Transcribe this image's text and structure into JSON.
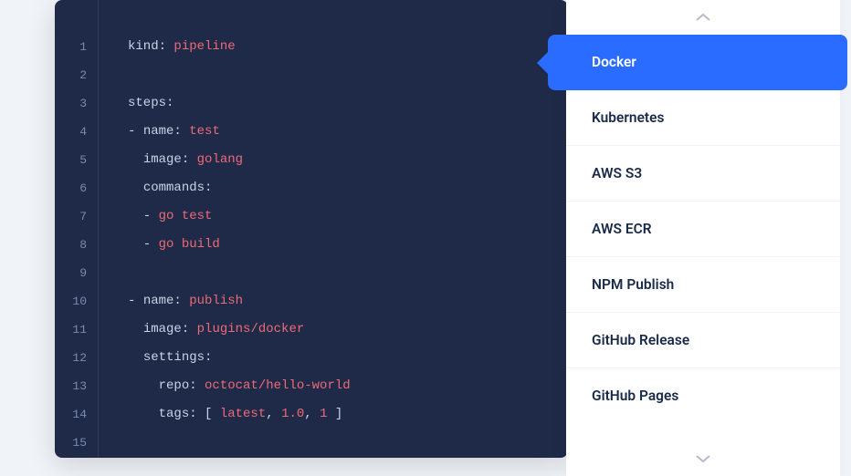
{
  "editor": {
    "line_count": 15,
    "lines": [
      [
        {
          "t": "key",
          "v": "kind"
        },
        {
          "t": "punct",
          "v": ": "
        },
        {
          "t": "val",
          "v": "pipeline"
        }
      ],
      [],
      [
        {
          "t": "key",
          "v": "steps"
        },
        {
          "t": "punct",
          "v": ":"
        }
      ],
      [
        {
          "t": "dash",
          "v": "- "
        },
        {
          "t": "key",
          "v": "name"
        },
        {
          "t": "punct",
          "v": ": "
        },
        {
          "t": "val",
          "v": "test"
        }
      ],
      [
        {
          "t": "dash",
          "v": "  "
        },
        {
          "t": "key",
          "v": "image"
        },
        {
          "t": "punct",
          "v": ": "
        },
        {
          "t": "val",
          "v": "golang"
        }
      ],
      [
        {
          "t": "dash",
          "v": "  "
        },
        {
          "t": "key",
          "v": "commands"
        },
        {
          "t": "punct",
          "v": ":"
        }
      ],
      [
        {
          "t": "dash",
          "v": "  - "
        },
        {
          "t": "val",
          "v": "go test"
        }
      ],
      [
        {
          "t": "dash",
          "v": "  - "
        },
        {
          "t": "val",
          "v": "go build"
        }
      ],
      [],
      [
        {
          "t": "dash",
          "v": "- "
        },
        {
          "t": "key",
          "v": "name"
        },
        {
          "t": "punct",
          "v": ": "
        },
        {
          "t": "val",
          "v": "publish"
        }
      ],
      [
        {
          "t": "dash",
          "v": "  "
        },
        {
          "t": "key",
          "v": "image"
        },
        {
          "t": "punct",
          "v": ": "
        },
        {
          "t": "val",
          "v": "plugins/docker"
        }
      ],
      [
        {
          "t": "dash",
          "v": "  "
        },
        {
          "t": "key",
          "v": "settings"
        },
        {
          "t": "punct",
          "v": ":"
        }
      ],
      [
        {
          "t": "dash",
          "v": "    "
        },
        {
          "t": "key",
          "v": "repo"
        },
        {
          "t": "punct",
          "v": ": "
        },
        {
          "t": "val",
          "v": "octocat/hello-world"
        }
      ],
      [
        {
          "t": "dash",
          "v": "    "
        },
        {
          "t": "key",
          "v": "tags"
        },
        {
          "t": "punct",
          "v": ": [ "
        },
        {
          "t": "val",
          "v": "latest"
        },
        {
          "t": "punct",
          "v": ", "
        },
        {
          "t": "val",
          "v": "1.0"
        },
        {
          "t": "punct",
          "v": ", "
        },
        {
          "t": "val",
          "v": "1"
        },
        {
          "t": "punct",
          "v": " ]"
        }
      ],
      []
    ]
  },
  "sidebar": {
    "items": [
      {
        "label": "Docker",
        "active": true
      },
      {
        "label": "Kubernetes",
        "active": false
      },
      {
        "label": "AWS S3",
        "active": false
      },
      {
        "label": "AWS ECR",
        "active": false
      },
      {
        "label": "NPM Publish",
        "active": false
      },
      {
        "label": "GitHub Release",
        "active": false
      },
      {
        "label": "GitHub Pages",
        "active": false
      }
    ]
  }
}
